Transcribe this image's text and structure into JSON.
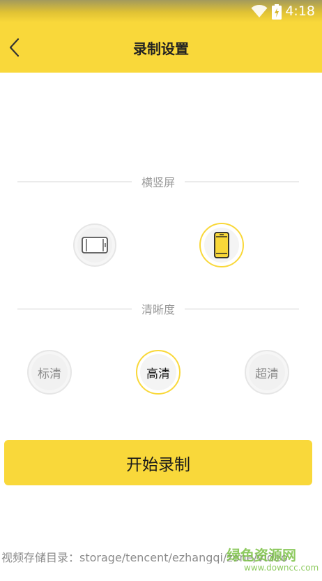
{
  "status_bar": {
    "time": "4:18"
  },
  "app_bar": {
    "title": "录制设置"
  },
  "orientation": {
    "header": "横竖屏",
    "selected": "portrait"
  },
  "quality": {
    "header": "清晰度",
    "options": [
      "标清",
      "高清",
      "超清"
    ],
    "selected": "高清"
  },
  "start_button": {
    "label": "开始录制"
  },
  "storage": {
    "path": "视频存储目录：storage/tencent/ezhangqi/zone/video"
  },
  "watermark": {
    "logo": "绿色资源网",
    "url": "www.downcc.com"
  },
  "colors": {
    "accent": "#f9d83a",
    "watermark": "#7bc145"
  }
}
